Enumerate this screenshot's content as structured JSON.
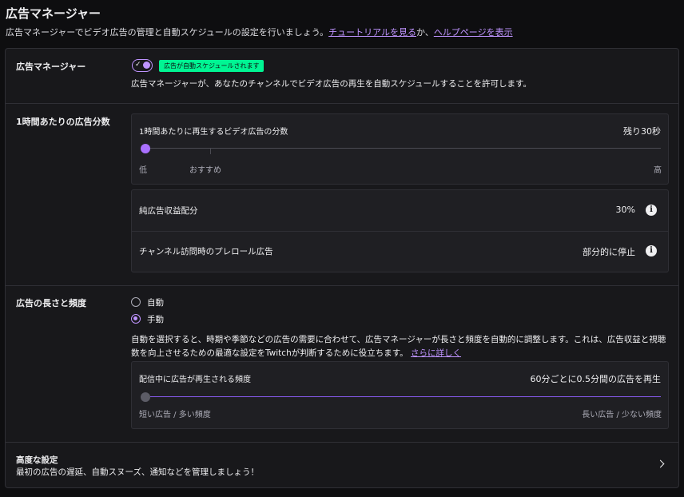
{
  "header": {
    "title": "広告マネージャー",
    "desc_prefix": "広告マネージャーでビデオ広告の管理と自動スケジュールの設定を行いましょう。",
    "tutorial_link": "チュートリアルを見る",
    "desc_middle": "か、",
    "help_link": "ヘルプページを表示"
  },
  "ads_manager": {
    "label": "広告マネージャー",
    "toggle_on": true,
    "badge": "広告が自動スケジュールされます",
    "description": "広告マネージャーが、あなたのチャンネルでビデオ広告の再生を自動スケジュールすることを許可します。"
  },
  "ad_minutes": {
    "label": "1時間あたりの広告分数",
    "slider_title": "1時間あたりに再生するビデオ広告の分数",
    "remaining": "残り30秒",
    "slider_position": 0.0,
    "low_label": "低",
    "recommended_label": "おすすめ",
    "high_label": "高",
    "revenue_label": "純広告収益配分",
    "revenue_value": "30%",
    "preroll_label": "チャンネル訪問時のプレロール広告",
    "preroll_value": "部分的に停止"
  },
  "length_frequency": {
    "label": "広告の長さと頻度",
    "options": [
      "自動",
      "手動"
    ],
    "selected": "手動",
    "description": "自動を選択すると、時期や季節などの広告の需要に合わせて、広告マネージャーが長さと頻度を自動的に調整します。これは、広告収益と視聴数を向上させるための最適な設定をTwitchが判断するために役立ちます。",
    "learn_more": "さらに詳しく",
    "slider_title": "配信中に広告が再生される頻度",
    "slider_value": "60分ごとに0.5分間の広告を再生",
    "slider_position": 0.0,
    "left_label": "短い広告 / 多い頻度",
    "right_label": "長い広告 / 少ない頻度"
  },
  "advanced": {
    "title": "高度な設定",
    "description": "最初の広告の遅延、自動スヌーズ、通知などを管理しましょう！"
  },
  "colors": {
    "accent": "#bf94ff",
    "badge_green": "#00f593",
    "background": "#0e0e10",
    "panel": "#18181b"
  },
  "icons": {
    "info": "info-icon",
    "chevron": "chevron-right-icon",
    "check": "check-icon"
  }
}
